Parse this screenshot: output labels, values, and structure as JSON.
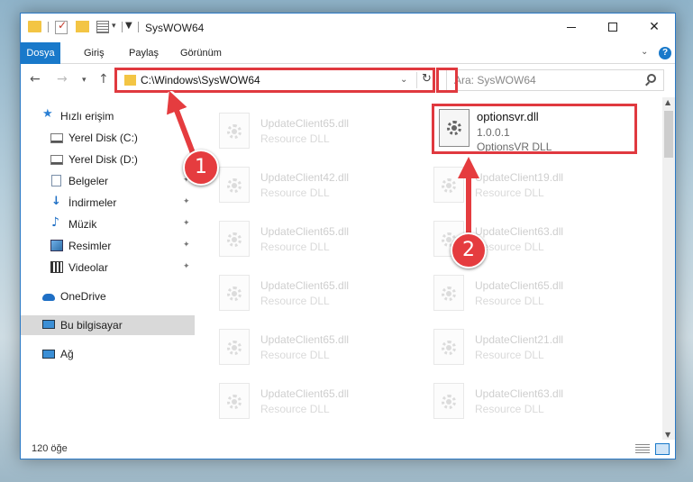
{
  "window": {
    "title": "SysWOW64",
    "minimize_label": "",
    "close_label": "✕"
  },
  "ribbon": {
    "tabs": [
      "Dosya",
      "Giriş",
      "Paylaş",
      "Görünüm"
    ],
    "help_label": "?"
  },
  "address": {
    "path": "C:\\Windows\\SysWOW64",
    "search_placeholder": "Ara: SysWOW64"
  },
  "sidebar": {
    "items": [
      {
        "label": "Hızlı erişim",
        "icon": "star-icon"
      },
      {
        "label": "Yerel Disk (C:)",
        "icon": "drive-icon"
      },
      {
        "label": "Yerel Disk (D:)",
        "icon": "drive-icon"
      },
      {
        "label": "Belgeler",
        "icon": "documents-icon",
        "pinned": true
      },
      {
        "label": "İndirmeler",
        "icon": "downloads-icon",
        "pinned": true
      },
      {
        "label": "Müzik",
        "icon": "music-icon",
        "pinned": true
      },
      {
        "label": "Resimler",
        "icon": "pictures-icon",
        "pinned": true
      },
      {
        "label": "Videolar",
        "icon": "videos-icon",
        "pinned": true
      },
      {
        "label": "OneDrive",
        "icon": "cloud-icon"
      },
      {
        "label": "Bu bilgisayar",
        "icon": "computer-icon",
        "selected": true
      },
      {
        "label": "Ağ",
        "icon": "network-icon"
      }
    ]
  },
  "files": {
    "highlighted": {
      "name": "optionsvr.dll",
      "version": "1.0.0.1",
      "type": "OptionsVR DLL"
    },
    "faded_left": [
      {
        "name": "UpdateClient65.dll",
        "type": "Resource DLL"
      },
      {
        "name": "UpdateClient42.dll",
        "type": "Resource DLL"
      },
      {
        "name": "UpdateClient65.dll",
        "type": "Resource DLL"
      },
      {
        "name": "UpdateClient65.dll",
        "type": "Resource DLL"
      },
      {
        "name": "UpdateClient65.dll",
        "type": "Resource DLL"
      },
      {
        "name": "UpdateClient65.dll",
        "type": "Resource DLL"
      }
    ],
    "faded_right": [
      {
        "name": "UpdateClient19.dll",
        "type": "Resource DLL"
      },
      {
        "name": "UpdateClient63.dll",
        "type": "Resource DLL"
      },
      {
        "name": "UpdateClient65.dll",
        "type": "Resource DLL"
      },
      {
        "name": "UpdateClient21.dll",
        "type": "Resource DLL"
      },
      {
        "name": "UpdateClient63.dll",
        "type": "Resource DLL"
      }
    ]
  },
  "status": {
    "item_count": "120 öğe"
  },
  "annotations": {
    "step1": "1",
    "step2": "2",
    "highlight_color": "#e0393f"
  }
}
